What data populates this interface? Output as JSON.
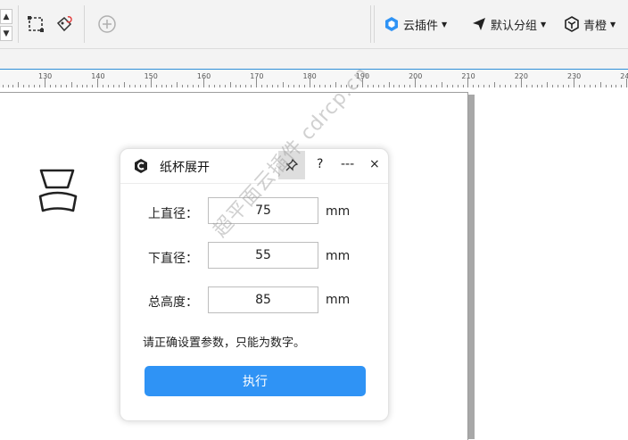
{
  "toolbar": {
    "menus": [
      {
        "icon": "cube-plugin-icon",
        "label": "云插件"
      },
      {
        "icon": "send-icon",
        "label": "默认分组"
      },
      {
        "icon": "hexagon-logo-icon",
        "label": "青橙"
      }
    ]
  },
  "ruler": {
    "labels": [
      "130",
      "140",
      "150",
      "160",
      "170",
      "180",
      "190",
      "200",
      "210",
      "220",
      "230",
      "24"
    ]
  },
  "dialog": {
    "title": "纸杯展开",
    "help": "?",
    "more": "---",
    "close": "×",
    "fields": [
      {
        "label": "上直径：",
        "value": "75",
        "unit": "mm"
      },
      {
        "label": "下直径：",
        "value": "55",
        "unit": "mm"
      },
      {
        "label": "总高度：",
        "value": "85",
        "unit": "mm"
      }
    ],
    "hint": "请正确设置参数，只能为数字。",
    "execute": "执行"
  },
  "watermark": "超平面云插件 cdrcp.cn",
  "colors": {
    "accent": "#2f93f5",
    "ruler_border": "#2f8fd7"
  }
}
